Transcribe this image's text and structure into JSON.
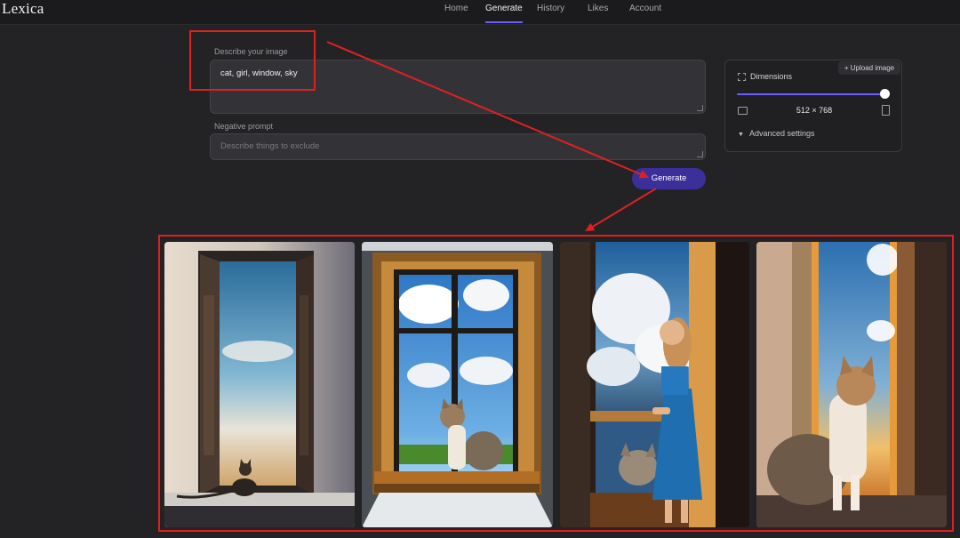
{
  "app": {
    "logo": "Lexica"
  },
  "nav": {
    "items": [
      {
        "label": "Home"
      },
      {
        "label": "Generate"
      },
      {
        "label": "History"
      },
      {
        "label": "Likes"
      },
      {
        "label": "Account"
      }
    ],
    "active": "Generate"
  },
  "prompt": {
    "label": "Describe your image",
    "value": "cat, girl, window, sky"
  },
  "negative": {
    "label": "Negative prompt",
    "placeholder": "Describe things to exclude"
  },
  "generate_button": "Generate",
  "settings": {
    "upload_label": "+ Upload image",
    "dimensions_label": "Dimensions",
    "size": "512 × 768",
    "advanced_label": "Advanced settings",
    "slider_fraction": 1.0
  },
  "colors": {
    "accent": "#6a5cff",
    "button": "#3b2f9a",
    "annotation": "#e02020"
  }
}
